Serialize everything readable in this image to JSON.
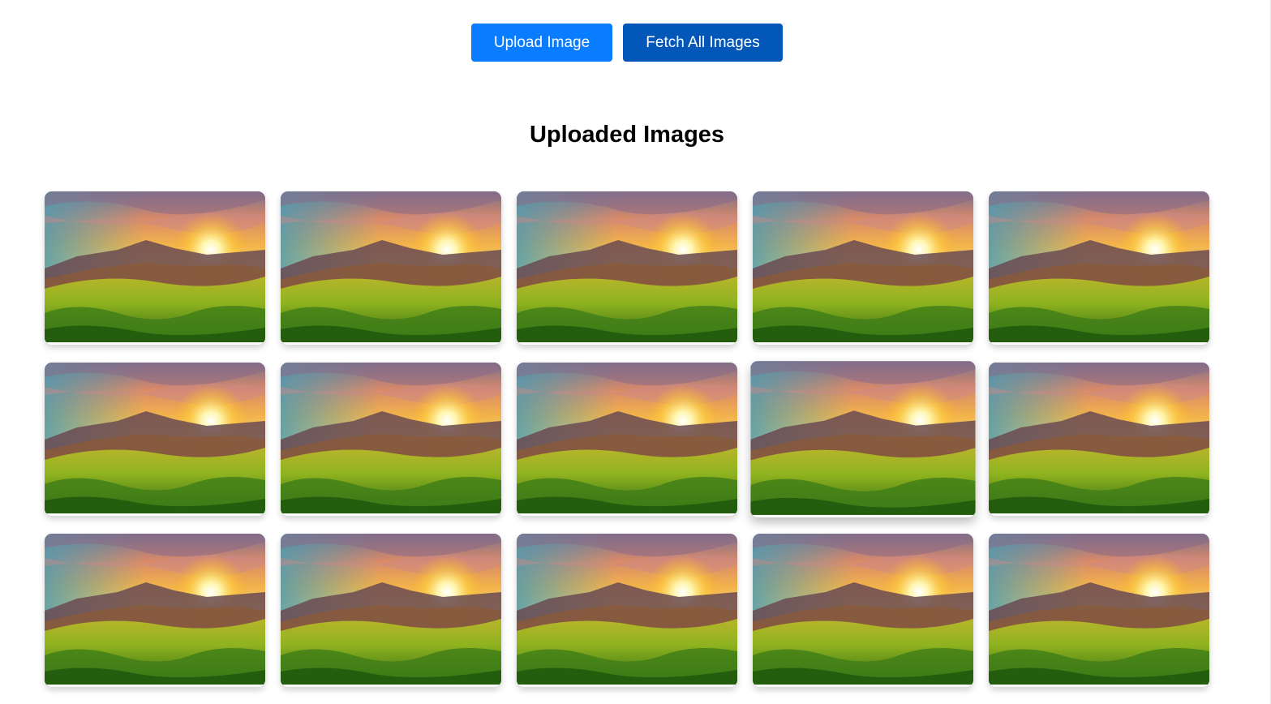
{
  "toolbar": {
    "upload_label": "Upload Image",
    "fetch_label": "Fetch All Images",
    "upload_color": "#0a7cff",
    "fetch_color": "#0257b8"
  },
  "gallery": {
    "title": "Uploaded Images",
    "image_count": 15,
    "columns": 5,
    "image_subject": "sunset-over-grassy-hills"
  }
}
